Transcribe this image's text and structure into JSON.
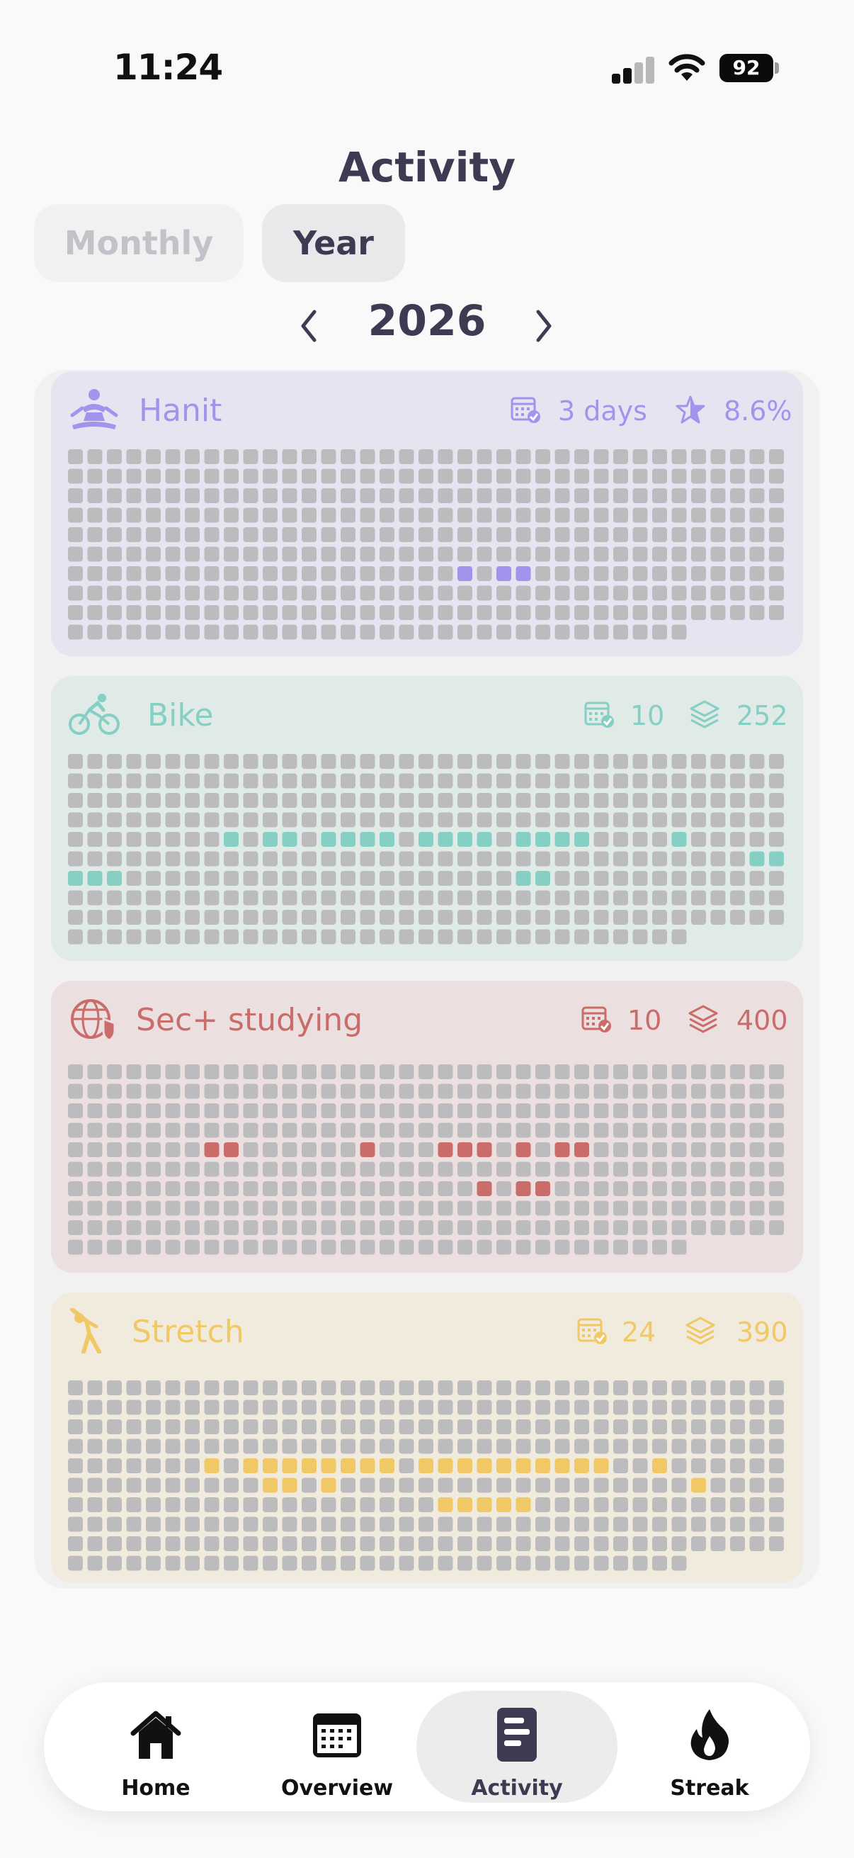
{
  "status_bar": {
    "time": "11:24",
    "battery": "92",
    "icons": [
      "signal-icon",
      "wifi-icon",
      "battery-icon"
    ]
  },
  "header": {
    "title": "Activity"
  },
  "view_toggle": {
    "monthly_label": "Monthly",
    "year_label": "Year",
    "selected": "Year"
  },
  "year_nav": {
    "year": "2026",
    "prev_icon": "chevron-left-icon",
    "next_icon": "chevron-right-icon"
  },
  "habits": [
    {
      "name": "Hanit",
      "icon": "meditation-icon",
      "stat1_icon": "calendar-check-icon",
      "stat1": "3 days",
      "stat2_icon": "star-icon",
      "stat2": "8.6%",
      "color": "#a493ec",
      "bg": "#e6e4f0",
      "active_cells": [
        [
          6,
          20
        ],
        [
          6,
          22
        ],
        [
          6,
          23
        ]
      ]
    },
    {
      "name": "Bike",
      "icon": "bicycle-icon",
      "stat1_icon": "calendar-check-icon",
      "stat1": "10",
      "stat2_icon": "layers-icon",
      "stat2": "252",
      "color": "#86cfc4",
      "bg": "#e0eae7",
      "active_cells": [
        [
          4,
          8
        ],
        [
          4,
          10
        ],
        [
          4,
          11
        ],
        [
          4,
          13
        ],
        [
          4,
          14
        ],
        [
          4,
          15
        ],
        [
          4,
          16
        ],
        [
          4,
          18
        ],
        [
          4,
          19
        ],
        [
          4,
          20
        ],
        [
          4,
          21
        ],
        [
          4,
          23
        ],
        [
          4,
          24
        ],
        [
          4,
          25
        ],
        [
          4,
          26
        ],
        [
          4,
          31
        ],
        [
          5,
          35
        ],
        [
          5,
          36
        ],
        [
          6,
          0
        ],
        [
          6,
          1
        ],
        [
          6,
          2
        ],
        [
          6,
          23
        ],
        [
          6,
          24
        ]
      ]
    },
    {
      "name": "Sec+ studying",
      "icon": "globe-shield-icon",
      "stat1_icon": "calendar-check-icon",
      "stat1": "10",
      "stat2_icon": "layers-icon",
      "stat2": "400",
      "color": "#c96c6a",
      "bg": "#ebdfdf",
      "active_cells": [
        [
          4,
          7
        ],
        [
          4,
          8
        ],
        [
          4,
          15
        ],
        [
          4,
          19
        ],
        [
          4,
          20
        ],
        [
          4,
          21
        ],
        [
          4,
          23
        ],
        [
          4,
          25
        ],
        [
          4,
          26
        ],
        [
          6,
          21
        ],
        [
          6,
          23
        ],
        [
          6,
          24
        ]
      ]
    },
    {
      "name": "Stretch",
      "icon": "stretch-icon",
      "stat1_icon": "calendar-check-icon",
      "stat1": "24",
      "stat2_icon": "layers-icon",
      "stat2": "390",
      "color": "#f1c866",
      "bg": "#f1ebde",
      "active_cells": [
        [
          4,
          7
        ],
        [
          4,
          9
        ],
        [
          4,
          10
        ],
        [
          4,
          11
        ],
        [
          4,
          12
        ],
        [
          4,
          13
        ],
        [
          4,
          14
        ],
        [
          4,
          15
        ],
        [
          4,
          16
        ],
        [
          4,
          18
        ],
        [
          4,
          19
        ],
        [
          4,
          20
        ],
        [
          4,
          21
        ],
        [
          4,
          22
        ],
        [
          4,
          23
        ],
        [
          4,
          24
        ],
        [
          4,
          25
        ],
        [
          4,
          26
        ],
        [
          4,
          27
        ],
        [
          4,
          30
        ],
        [
          5,
          10
        ],
        [
          5,
          11
        ],
        [
          5,
          13
        ],
        [
          5,
          32
        ],
        [
          6,
          19
        ],
        [
          6,
          20
        ],
        [
          6,
          21
        ],
        [
          6,
          22
        ],
        [
          6,
          23
        ]
      ]
    }
  ],
  "grid": {
    "rows": 10,
    "cols": 37,
    "last_row_cols": 32,
    "empty_color": "#bcbcbf"
  },
  "bottom_nav": {
    "items": [
      {
        "label": "Home",
        "icon": "home-icon"
      },
      {
        "label": "Overview",
        "icon": "calendar-grid-icon"
      },
      {
        "label": "Activity",
        "icon": "activity-list-icon"
      },
      {
        "label": "Streak",
        "icon": "flame-icon"
      }
    ],
    "active": "Activity"
  }
}
